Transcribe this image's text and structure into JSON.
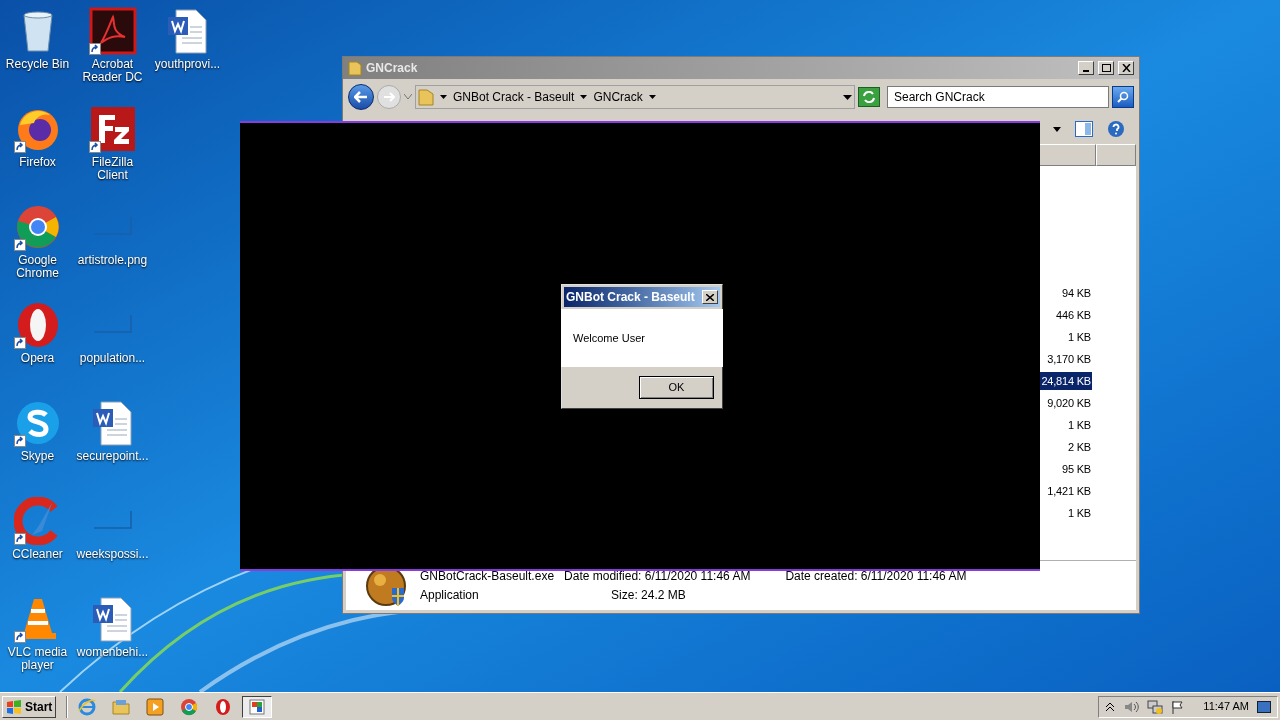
{
  "desktop_icons": [
    {
      "label": "Recycle Bin",
      "kind": "recycle",
      "shortcut": false
    },
    {
      "label": "Firefox",
      "kind": "firefox",
      "shortcut": true
    },
    {
      "label": "Google Chrome",
      "kind": "chrome",
      "shortcut": true
    },
    {
      "label": "Opera",
      "kind": "opera",
      "shortcut": true
    },
    {
      "label": "Skype",
      "kind": "skype",
      "shortcut": true
    },
    {
      "label": "CCleaner",
      "kind": "ccleaner",
      "shortcut": true
    },
    {
      "label": "VLC media player",
      "kind": "vlc",
      "shortcut": true
    },
    {
      "label": "Acrobat Reader DC",
      "kind": "pdf",
      "shortcut": true
    },
    {
      "label": "FileZilla Client",
      "kind": "filezilla",
      "shortcut": true
    },
    {
      "label": "artistrole.png",
      "kind": "image",
      "shortcut": false
    },
    {
      "label": "population...",
      "kind": "image",
      "shortcut": false
    },
    {
      "label": "securepoint...",
      "kind": "word",
      "shortcut": false
    },
    {
      "label": "weekspossi...",
      "kind": "image",
      "shortcut": false
    },
    {
      "label": "womenbehi...",
      "kind": "word",
      "shortcut": false
    },
    {
      "label": "youthprovi...",
      "kind": "word",
      "shortcut": false
    }
  ],
  "explorer": {
    "title": "GNCrack",
    "breadcrumb": [
      "GNBot Crack - Baseult",
      "GNCrack"
    ],
    "search": {
      "placeholder": "Search GNCrack"
    },
    "sizes": [
      {
        "text": "94 KB",
        "selected": false
      },
      {
        "text": "446 KB",
        "selected": false
      },
      {
        "text": "1 KB",
        "selected": false
      },
      {
        "text": "3,170 KB",
        "selected": false
      },
      {
        "text": "24,814 KB",
        "selected": true
      },
      {
        "text": "9,020 KB",
        "selected": false
      },
      {
        "text": "1 KB",
        "selected": false
      },
      {
        "text": "2 KB",
        "selected": false
      },
      {
        "text": "95 KB",
        "selected": false
      },
      {
        "text": "1,421 KB",
        "selected": false
      },
      {
        "text": "1 KB",
        "selected": false
      }
    ],
    "details": {
      "name": "GNBotCrack-Baseult.exe",
      "type": "Application",
      "modified_label": "Date modified:",
      "modified": "6/11/2020 11:46 AM",
      "created_label": "Date created:",
      "created": "6/11/2020 11:46 AM",
      "size_label": "Size:",
      "size": "24.2 MB"
    }
  },
  "dialog": {
    "title": "GNBot Crack - Baseult",
    "message": "Welcome User",
    "button": "OK"
  },
  "taskbar": {
    "start": "Start",
    "apps": [
      {
        "kind": "ie",
        "selected": false
      },
      {
        "kind": "folder",
        "selected": false
      },
      {
        "kind": "media",
        "selected": false
      },
      {
        "kind": "chrome",
        "selected": false
      },
      {
        "kind": "opera",
        "selected": false
      },
      {
        "kind": "app",
        "selected": true
      }
    ],
    "clock": "11:47 AM"
  }
}
